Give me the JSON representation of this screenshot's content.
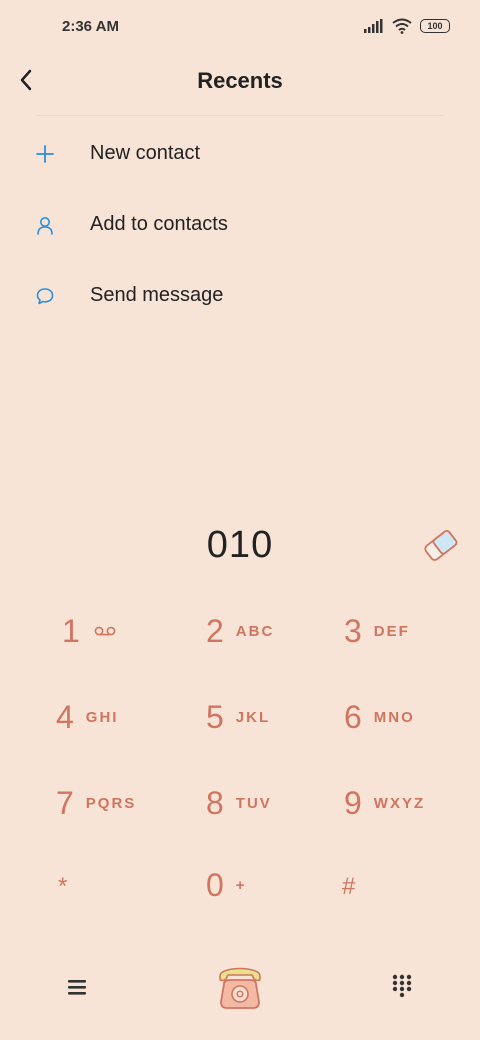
{
  "status": {
    "time": "2:36 AM",
    "battery": "100"
  },
  "header": {
    "title": "Recents"
  },
  "menu": {
    "items": [
      {
        "label": "New contact",
        "icon": "plus-icon"
      },
      {
        "label": "Add to contacts",
        "icon": "person-icon"
      },
      {
        "label": "Send message",
        "icon": "message-icon"
      }
    ]
  },
  "dial": {
    "number": "010"
  },
  "keypad": {
    "keys": [
      {
        "digit": "1",
        "letters": ""
      },
      {
        "digit": "2",
        "letters": "ABC"
      },
      {
        "digit": "3",
        "letters": "DEF"
      },
      {
        "digit": "4",
        "letters": "GHI"
      },
      {
        "digit": "5",
        "letters": "JKL"
      },
      {
        "digit": "6",
        "letters": "MNO"
      },
      {
        "digit": "7",
        "letters": "PQRS"
      },
      {
        "digit": "8",
        "letters": "TUV"
      },
      {
        "digit": "9",
        "letters": "WXYZ"
      },
      {
        "digit": "*",
        "letters": ""
      },
      {
        "digit": "0",
        "letters": "+"
      },
      {
        "digit": "#",
        "letters": ""
      }
    ]
  },
  "colors": {
    "accent": "#2a8fe0",
    "key": "#cf7560",
    "background": "#f8e4d6"
  }
}
